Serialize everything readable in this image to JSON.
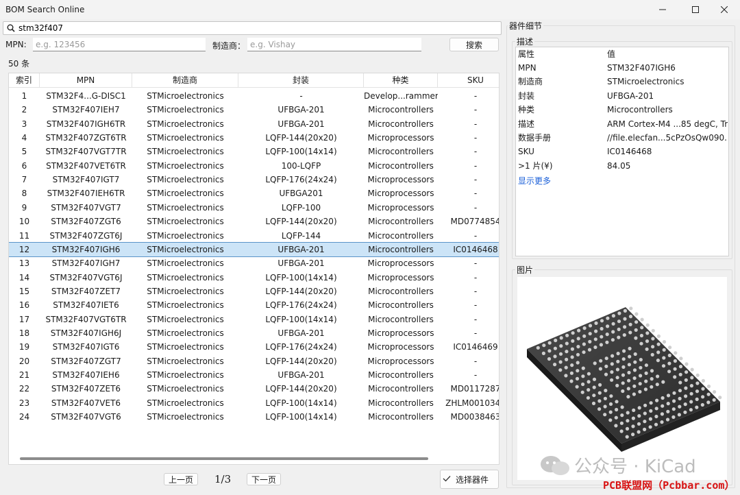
{
  "window": {
    "title": "BOM Search Online"
  },
  "search": {
    "value": "stm32f407"
  },
  "filters": {
    "mpn_label": "MPN:",
    "mpn_placeholder": "e.g. 123456",
    "manufacturer_label": "制造商：",
    "manufacturer_placeholder": "e.g. Vishay",
    "search_button": "搜索"
  },
  "result_count": "50 条",
  "table": {
    "columns": [
      "索引",
      "MPN",
      "制造商",
      "封装",
      "种类",
      "SKU"
    ],
    "selected_index": 11,
    "rows": [
      [
        "1",
        "STM32F4...G-DISC1",
        "STMicroelectronics",
        "-",
        "Develop...rammers",
        "-"
      ],
      [
        "2",
        "STM32F407IEH7",
        "STMicroelectronics",
        "UFBGA-201",
        "Microcontrollers",
        "-"
      ],
      [
        "3",
        "STM32F407IGH6TR",
        "STMicroelectronics",
        "UFBGA-201",
        "Microcontrollers",
        "-"
      ],
      [
        "4",
        "STM32F407ZGT6TR",
        "STMicroelectronics",
        "LQFP-144(20x20)",
        "Microprocessors",
        "-"
      ],
      [
        "5",
        "STM32F407VGT7TR",
        "STMicroelectronics",
        "LQFP-100(14x14)",
        "Microcontrollers",
        "-"
      ],
      [
        "6",
        "STM32F407VET6TR",
        "STMicroelectronics",
        "100-LQFP",
        "Microcontrollers",
        "-"
      ],
      [
        "7",
        "STM32F407IGT7",
        "STMicroelectronics",
        "LQFP-176(24x24)",
        "Microprocessors",
        "-"
      ],
      [
        "8",
        "STM32F407IEH6TR",
        "STMicroelectronics",
        "UFBGA201",
        "Microprocessors",
        "-"
      ],
      [
        "9",
        "STM32F407VGT7",
        "STMicroelectronics",
        "LQFP-100",
        "Microprocessors",
        "-"
      ],
      [
        "10",
        "STM32F407ZGT6",
        "STMicroelectronics",
        "LQFP-144(20x20)",
        "Microcontrollers",
        "MD0774854"
      ],
      [
        "11",
        "STM32F407ZGT6J",
        "STMicroelectronics",
        "LQFP-144",
        "Microcontrollers",
        "-"
      ],
      [
        "12",
        "STM32F407IGH6",
        "STMicroelectronics",
        "UFBGA-201",
        "Microcontrollers",
        "IC0146468"
      ],
      [
        "13",
        "STM32F407IGH7",
        "STMicroelectronics",
        "UFBGA-201",
        "Microprocessors",
        "-"
      ],
      [
        "14",
        "STM32F407VGT6J",
        "STMicroelectronics",
        "LQFP-100(14x14)",
        "Microprocessors",
        "-"
      ],
      [
        "15",
        "STM32F407ZET7",
        "STMicroelectronics",
        "LQFP-144(20x20)",
        "Microcontrollers",
        "-"
      ],
      [
        "16",
        "STM32F407IET6",
        "STMicroelectronics",
        "LQFP-176(24x24)",
        "Microcontrollers",
        "-"
      ],
      [
        "17",
        "STM32F407VGT6TR",
        "STMicroelectronics",
        "LQFP-100(14x14)",
        "Microcontrollers",
        "-"
      ],
      [
        "18",
        "STM32F407IGH6J",
        "STMicroelectronics",
        "UFBGA-201",
        "Microprocessors",
        "-"
      ],
      [
        "19",
        "STM32F407IGT6",
        "STMicroelectronics",
        "LQFP-176(24x24)",
        "Microprocessors",
        "IC0146469"
      ],
      [
        "20",
        "STM32F407ZGT7",
        "STMicroelectronics",
        "LQFP-144(20x20)",
        "Microprocessors",
        "-"
      ],
      [
        "21",
        "STM32F407IEH6",
        "STMicroelectronics",
        "UFBGA-201",
        "Microcontrollers",
        "-"
      ],
      [
        "22",
        "STM32F407ZET6",
        "STMicroelectronics",
        "LQFP-144(20x20)",
        "Microcontrollers",
        "MD0117287"
      ],
      [
        "23",
        "STM32F407VET6",
        "STMicroelectronics",
        "LQFP-100(14x14)",
        "Microcontrollers",
        "ZHLM0010349"
      ],
      [
        "24",
        "STM32F407VGT6",
        "STMicroelectronics",
        "LQFP-100(14x14)",
        "Microcontrollers",
        "MD0038463"
      ]
    ]
  },
  "pager": {
    "prev": "上一页",
    "page": "1/3",
    "next": "下一页"
  },
  "select_button": "选择器件",
  "details": {
    "group_title": "器件细节",
    "desc_title": "描述",
    "header": [
      "属性",
      "值"
    ],
    "rows": [
      [
        "MPN",
        "STM32F407IGH6"
      ],
      [
        "制造商",
        "STMicroelectronics"
      ],
      [
        "封装",
        "UFBGA-201"
      ],
      [
        "种类",
        "Microcontrollers"
      ],
      [
        "描述",
        "ARM Cortex-M4 ...85 degC, Tray"
      ],
      [
        "数据手册",
        "//file.elecfan...5cPzOsQw090.pdf"
      ],
      [
        "SKU",
        "IC0146468"
      ],
      [
        ">1 片(¥)",
        "84.05"
      ]
    ],
    "show_more": "显示更多",
    "image_title": "图片"
  },
  "watermark": {
    "text": "公众号 · KiCad",
    "site": "PCB联盟网（Pcbbar.com）"
  },
  "colors": {
    "selection": "#cce4f7",
    "selection_border": "#5a94c8",
    "link": "#1a5fd8",
    "watermark_red": "#d81414"
  }
}
